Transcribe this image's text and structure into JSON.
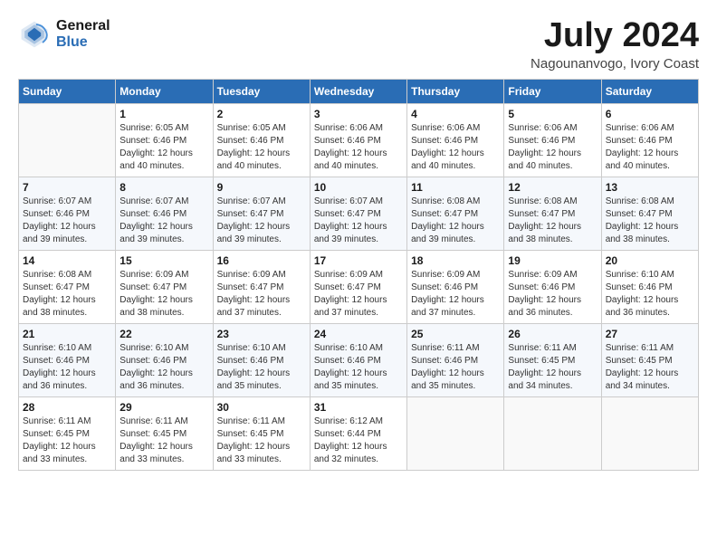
{
  "header": {
    "logo_line1": "General",
    "logo_line2": "Blue",
    "month_year": "July 2024",
    "location": "Nagounanvogo, Ivory Coast"
  },
  "weekdays": [
    "Sunday",
    "Monday",
    "Tuesday",
    "Wednesday",
    "Thursday",
    "Friday",
    "Saturday"
  ],
  "weeks": [
    [
      {
        "day": "",
        "info": ""
      },
      {
        "day": "1",
        "info": "Sunrise: 6:05 AM\nSunset: 6:46 PM\nDaylight: 12 hours\nand 40 minutes."
      },
      {
        "day": "2",
        "info": "Sunrise: 6:05 AM\nSunset: 6:46 PM\nDaylight: 12 hours\nand 40 minutes."
      },
      {
        "day": "3",
        "info": "Sunrise: 6:06 AM\nSunset: 6:46 PM\nDaylight: 12 hours\nand 40 minutes."
      },
      {
        "day": "4",
        "info": "Sunrise: 6:06 AM\nSunset: 6:46 PM\nDaylight: 12 hours\nand 40 minutes."
      },
      {
        "day": "5",
        "info": "Sunrise: 6:06 AM\nSunset: 6:46 PM\nDaylight: 12 hours\nand 40 minutes."
      },
      {
        "day": "6",
        "info": "Sunrise: 6:06 AM\nSunset: 6:46 PM\nDaylight: 12 hours\nand 40 minutes."
      }
    ],
    [
      {
        "day": "7",
        "info": "Sunrise: 6:07 AM\nSunset: 6:46 PM\nDaylight: 12 hours\nand 39 minutes."
      },
      {
        "day": "8",
        "info": "Sunrise: 6:07 AM\nSunset: 6:46 PM\nDaylight: 12 hours\nand 39 minutes."
      },
      {
        "day": "9",
        "info": "Sunrise: 6:07 AM\nSunset: 6:47 PM\nDaylight: 12 hours\nand 39 minutes."
      },
      {
        "day": "10",
        "info": "Sunrise: 6:07 AM\nSunset: 6:47 PM\nDaylight: 12 hours\nand 39 minutes."
      },
      {
        "day": "11",
        "info": "Sunrise: 6:08 AM\nSunset: 6:47 PM\nDaylight: 12 hours\nand 39 minutes."
      },
      {
        "day": "12",
        "info": "Sunrise: 6:08 AM\nSunset: 6:47 PM\nDaylight: 12 hours\nand 38 minutes."
      },
      {
        "day": "13",
        "info": "Sunrise: 6:08 AM\nSunset: 6:47 PM\nDaylight: 12 hours\nand 38 minutes."
      }
    ],
    [
      {
        "day": "14",
        "info": "Sunrise: 6:08 AM\nSunset: 6:47 PM\nDaylight: 12 hours\nand 38 minutes."
      },
      {
        "day": "15",
        "info": "Sunrise: 6:09 AM\nSunset: 6:47 PM\nDaylight: 12 hours\nand 38 minutes."
      },
      {
        "day": "16",
        "info": "Sunrise: 6:09 AM\nSunset: 6:47 PM\nDaylight: 12 hours\nand 37 minutes."
      },
      {
        "day": "17",
        "info": "Sunrise: 6:09 AM\nSunset: 6:47 PM\nDaylight: 12 hours\nand 37 minutes."
      },
      {
        "day": "18",
        "info": "Sunrise: 6:09 AM\nSunset: 6:46 PM\nDaylight: 12 hours\nand 37 minutes."
      },
      {
        "day": "19",
        "info": "Sunrise: 6:09 AM\nSunset: 6:46 PM\nDaylight: 12 hours\nand 36 minutes."
      },
      {
        "day": "20",
        "info": "Sunrise: 6:10 AM\nSunset: 6:46 PM\nDaylight: 12 hours\nand 36 minutes."
      }
    ],
    [
      {
        "day": "21",
        "info": "Sunrise: 6:10 AM\nSunset: 6:46 PM\nDaylight: 12 hours\nand 36 minutes."
      },
      {
        "day": "22",
        "info": "Sunrise: 6:10 AM\nSunset: 6:46 PM\nDaylight: 12 hours\nand 36 minutes."
      },
      {
        "day": "23",
        "info": "Sunrise: 6:10 AM\nSunset: 6:46 PM\nDaylight: 12 hours\nand 35 minutes."
      },
      {
        "day": "24",
        "info": "Sunrise: 6:10 AM\nSunset: 6:46 PM\nDaylight: 12 hours\nand 35 minutes."
      },
      {
        "day": "25",
        "info": "Sunrise: 6:11 AM\nSunset: 6:46 PM\nDaylight: 12 hours\nand 35 minutes."
      },
      {
        "day": "26",
        "info": "Sunrise: 6:11 AM\nSunset: 6:45 PM\nDaylight: 12 hours\nand 34 minutes."
      },
      {
        "day": "27",
        "info": "Sunrise: 6:11 AM\nSunset: 6:45 PM\nDaylight: 12 hours\nand 34 minutes."
      }
    ],
    [
      {
        "day": "28",
        "info": "Sunrise: 6:11 AM\nSunset: 6:45 PM\nDaylight: 12 hours\nand 33 minutes."
      },
      {
        "day": "29",
        "info": "Sunrise: 6:11 AM\nSunset: 6:45 PM\nDaylight: 12 hours\nand 33 minutes."
      },
      {
        "day": "30",
        "info": "Sunrise: 6:11 AM\nSunset: 6:45 PM\nDaylight: 12 hours\nand 33 minutes."
      },
      {
        "day": "31",
        "info": "Sunrise: 6:12 AM\nSunset: 6:44 PM\nDaylight: 12 hours\nand 32 minutes."
      },
      {
        "day": "",
        "info": ""
      },
      {
        "day": "",
        "info": ""
      },
      {
        "day": "",
        "info": ""
      }
    ]
  ]
}
